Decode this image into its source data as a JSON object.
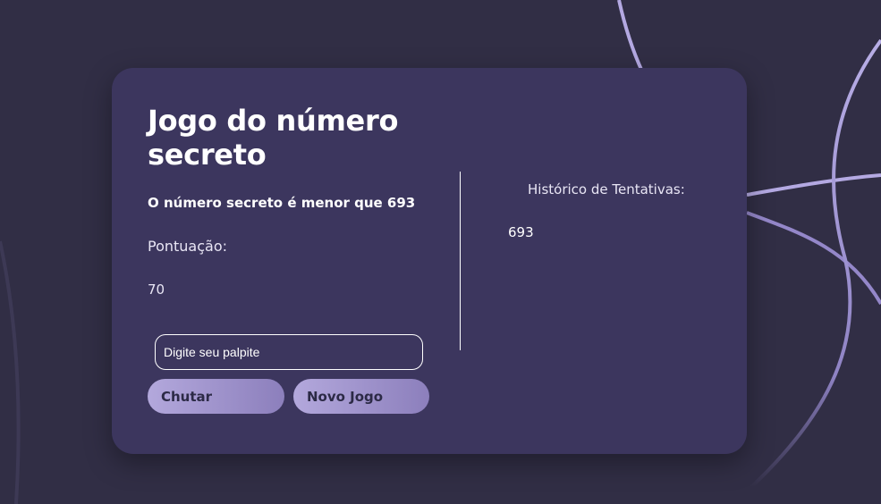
{
  "game": {
    "title": "Jogo do número secreto",
    "hint": "O número secreto é menor que 693",
    "score_label": "Pontuação:",
    "score_value": "70",
    "input_placeholder": "Digite seu palpite",
    "guess_button": "Chutar",
    "new_game_button": "Novo Jogo"
  },
  "history": {
    "label": "Histórico de Tentativas:",
    "items": [
      "693"
    ]
  },
  "colors": {
    "background": "#312e45",
    "card": "#3c365e",
    "button_gradient_start": "#b3a8dc",
    "button_gradient_end": "#8c7fbc",
    "button_text": "#2c2a46",
    "decorative_lines": "#a99cd8"
  }
}
